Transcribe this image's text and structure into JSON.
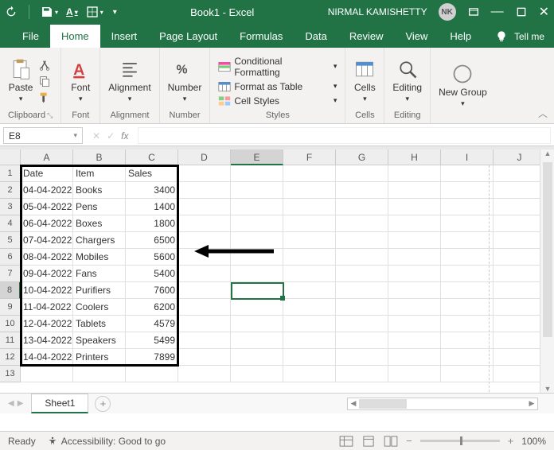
{
  "title": "Book1 - Excel",
  "user_name": "NIRMAL KAMISHETTY",
  "user_initials": "NK",
  "tabs": [
    "File",
    "Home",
    "Insert",
    "Page Layout",
    "Formulas",
    "Data",
    "Review",
    "View",
    "Help"
  ],
  "active_tab": "Home",
  "tell_me": "Tell me",
  "ribbon": {
    "clipboard": {
      "label": "Clipboard",
      "paste": "Paste"
    },
    "font": {
      "label": "Font",
      "btn": "Font"
    },
    "alignment": {
      "label": "Alignment",
      "btn": "Alignment"
    },
    "number": {
      "label": "Number",
      "btn": "Number"
    },
    "styles": {
      "label": "Styles",
      "cond": "Conditional Formatting",
      "table": "Format as Table",
      "cell": "Cell Styles"
    },
    "cells": {
      "label": "Cells",
      "btn": "Cells"
    },
    "editing": {
      "label": "Editing",
      "btn": "Editing"
    },
    "newgroup": {
      "label": "",
      "btn": "New Group"
    }
  },
  "name_box": "E8",
  "columns": [
    "A",
    "B",
    "C",
    "D",
    "E",
    "F",
    "G",
    "H",
    "I",
    "J"
  ],
  "rows": [
    "1",
    "2",
    "3",
    "4",
    "5",
    "6",
    "7",
    "8",
    "9",
    "10",
    "11",
    "12",
    "13"
  ],
  "selected_col_index": 4,
  "selected_row_index": 7,
  "headers": [
    "Date",
    "Item",
    "Sales"
  ],
  "data": [
    [
      "04-04-2022",
      "Books",
      "3400"
    ],
    [
      "05-04-2022",
      "Pens",
      "1400"
    ],
    [
      "06-04-2022",
      "Boxes",
      "1800"
    ],
    [
      "07-04-2022",
      "Chargers",
      "6500"
    ],
    [
      "08-04-2022",
      "Mobiles",
      "5600"
    ],
    [
      "09-04-2022",
      "Fans",
      "5400"
    ],
    [
      "10-04-2022",
      "Purifiers",
      "7600"
    ],
    [
      "11-04-2022",
      "Coolers",
      "6200"
    ],
    [
      "12-04-2022",
      "Tablets",
      "4579"
    ],
    [
      "13-04-2022",
      "Speakers",
      "5499"
    ],
    [
      "14-04-2022",
      "Printers",
      "7899"
    ]
  ],
  "sheet_tab": "Sheet1",
  "status_ready": "Ready",
  "accessibility": "Accessibility: Good to go",
  "zoom": "100%"
}
